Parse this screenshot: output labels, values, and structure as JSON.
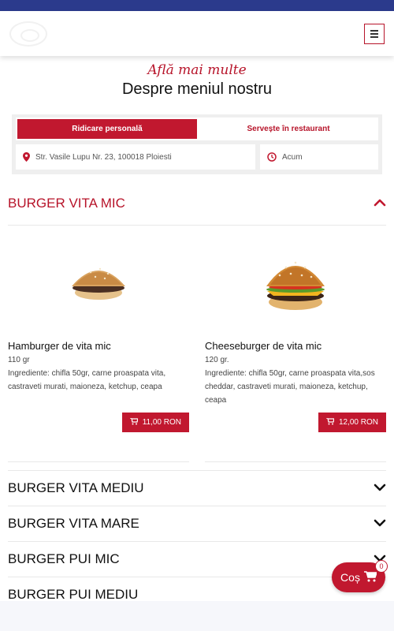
{
  "header": {
    "logo_icon": "restaurant-logo",
    "menu_icon": "hamburger-menu-icon"
  },
  "intro": {
    "tagline": "Află mai multe",
    "title": "Despre meniul nostru"
  },
  "order": {
    "tabs": [
      {
        "label": "Ridicare personală",
        "active": true
      },
      {
        "label": "Servește în restaurant",
        "active": false
      }
    ],
    "address": "Str. Vasile Lupu Nr. 23, 100018 Ploiesti",
    "time": "Acum"
  },
  "categories": [
    {
      "title": "BURGER VITA MIC",
      "open": true,
      "products": [
        {
          "name": "Hamburger de vita mic",
          "weight": "110 gr",
          "ingredients": "Ingrediente: chifla 50gr, carne proaspata vita, castraveti murati, maioneza, ketchup, ceapa",
          "price": "11,00 RON"
        },
        {
          "name": "Cheeseburger de vita mic",
          "weight": "120 gr.",
          "ingredients": "Ingrediente: chifla 50gr, carne proaspata vita,sos cheddar, castraveti murati, maioneza, ketchup, ceapa",
          "price": "12,00 RON"
        }
      ]
    },
    {
      "title": "BURGER VITA MEDIU",
      "open": false
    },
    {
      "title": "BURGER VITA MARE",
      "open": false
    },
    {
      "title": "BURGER PUI MIC",
      "open": false
    },
    {
      "title": "BURGER PUI MEDIU",
      "open": false
    }
  ],
  "cart": {
    "label": "Coș",
    "count": "0"
  },
  "colors": {
    "accent": "#c1182f",
    "topbar": "#2b3a8c"
  }
}
